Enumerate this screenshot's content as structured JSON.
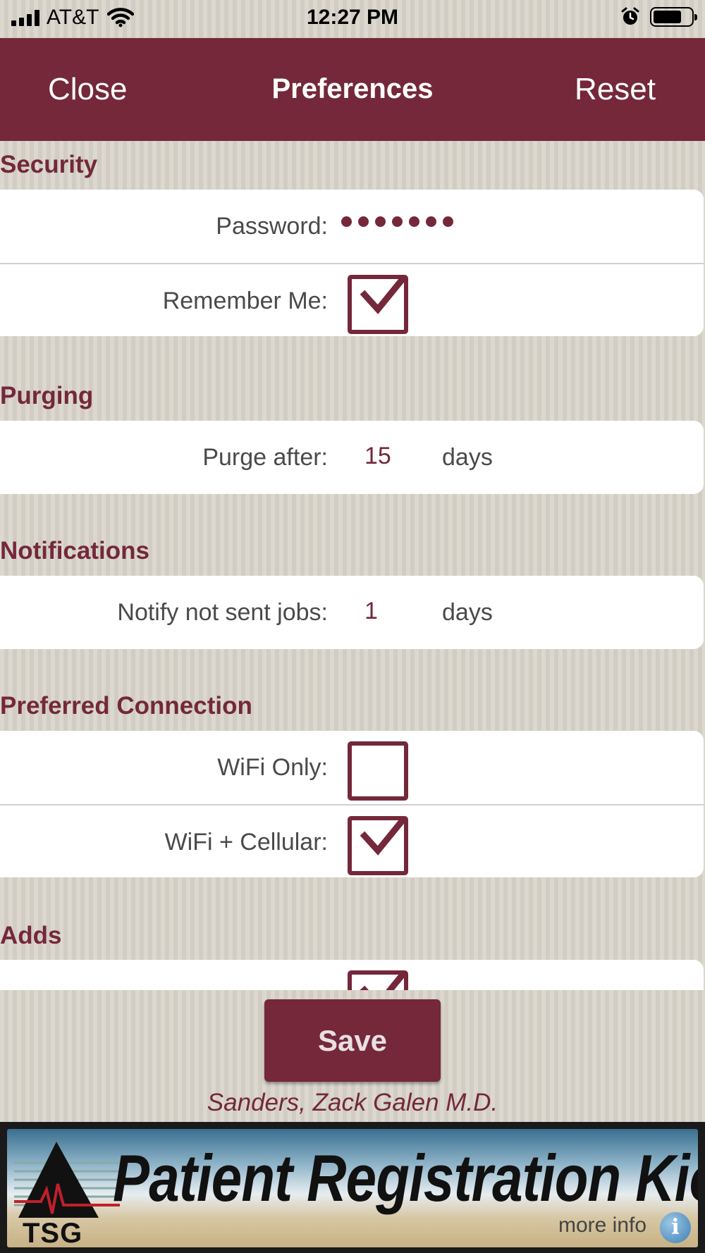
{
  "status_bar": {
    "carrier": "AT&T",
    "time": "12:27 PM",
    "battery_level": 0.75
  },
  "nav": {
    "close_label": "Close",
    "title": "Preferences",
    "reset_label": "Reset"
  },
  "sections": {
    "security": {
      "header": "Security",
      "password_label": "Password:",
      "password_masked": "•••••••",
      "remember_label": "Remember Me:",
      "remember_checked": true
    },
    "purging": {
      "header": "Purging",
      "purge_label": "Purge after:",
      "purge_value": "15",
      "purge_unit": "days"
    },
    "notifications": {
      "header": "Notifications",
      "notify_label": "Notify not sent jobs:",
      "notify_value": "1",
      "notify_unit": "days"
    },
    "connection": {
      "header": "Preferred Connection",
      "wifi_only_label": "WiFi Only:",
      "wifi_only_checked": false,
      "wifi_cellular_label": "WiFi + Cellular:",
      "wifi_cellular_checked": true
    },
    "adds": {
      "header": "Adds",
      "checked": true
    }
  },
  "footer": {
    "save_label": "Save",
    "doctor_name": "Sanders, Zack Galen M.D."
  },
  "banner": {
    "logo_text": "TSG",
    "title": "Patient Registration Kiosk",
    "more_info": "more info",
    "info_glyph": "i"
  },
  "colors": {
    "brand": "#74283a",
    "background": "#d9d5cc",
    "label": "#4a4a4a"
  }
}
